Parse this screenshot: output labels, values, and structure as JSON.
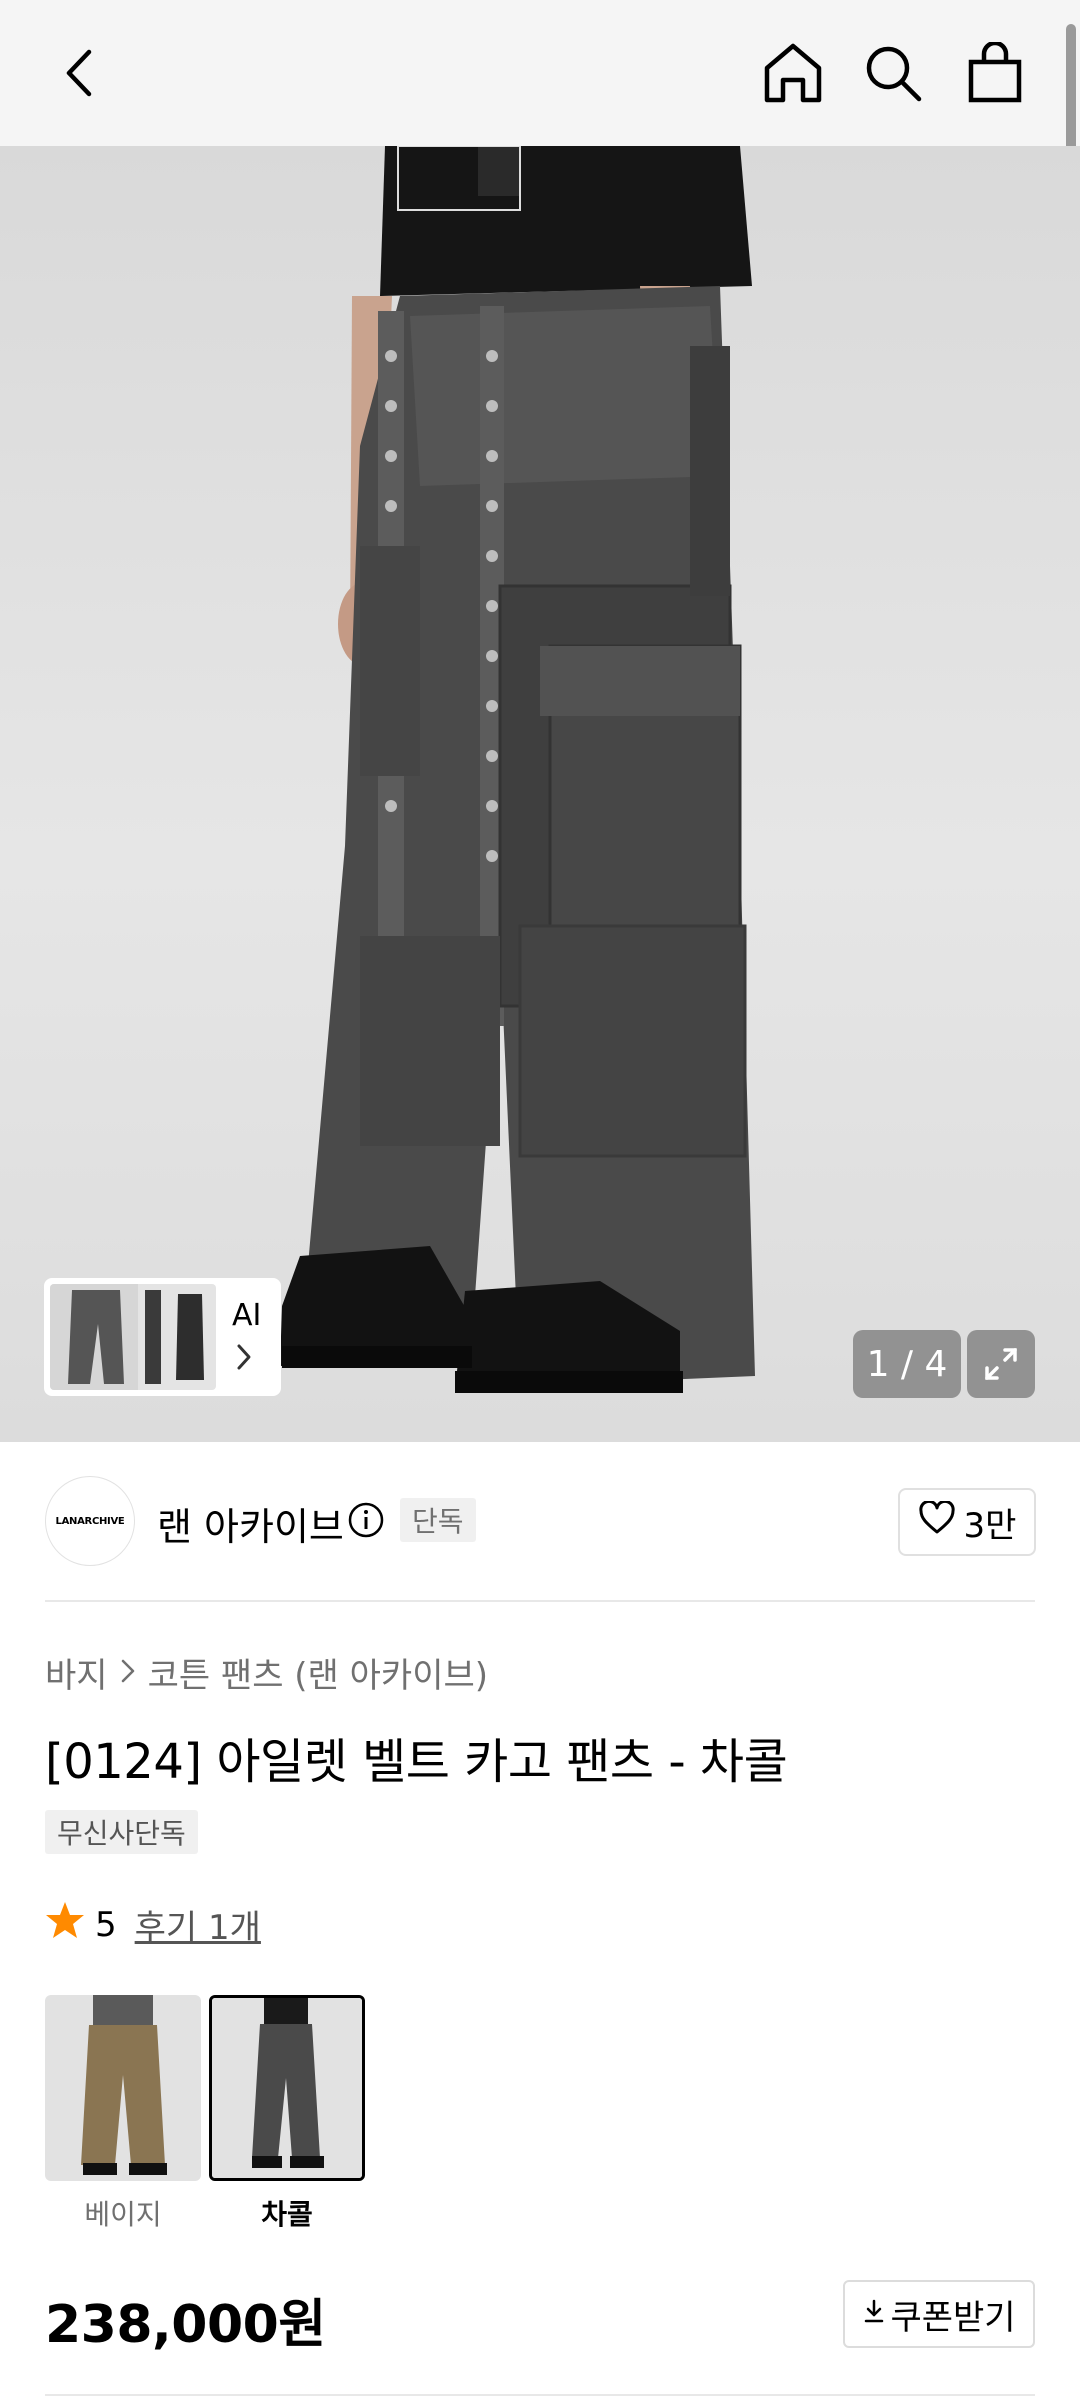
{
  "nav": {
    "back": "back-icon",
    "home": "home-icon",
    "search": "search-icon",
    "cart": "shopping-bag-icon"
  },
  "gallery": {
    "counter": "1 / 4",
    "ai_label": "AI"
  },
  "brand": {
    "logo_text": "LANARCHIVE",
    "name": "랜 아카이브",
    "badge": "단독",
    "likes": "3만"
  },
  "breadcrumb": {
    "category": "바지",
    "subcategory": "코튼 팬츠 (랜 아카이브)"
  },
  "product": {
    "title": "[0124] 아일렛 벨트 카고 팬츠 - 차콜",
    "tag": "무신사단독",
    "rating": "5",
    "reviews": "후기 1개",
    "price": "238,000원"
  },
  "variants": [
    {
      "label": "베이지",
      "selected": false
    },
    {
      "label": "차콜",
      "selected": true
    }
  ],
  "coupon": {
    "label": "쿠폰받기"
  },
  "colors": {
    "star": "#FF8A00",
    "charcoal_pants": "#4a4a4a",
    "beige_pants": "#8a7552"
  }
}
